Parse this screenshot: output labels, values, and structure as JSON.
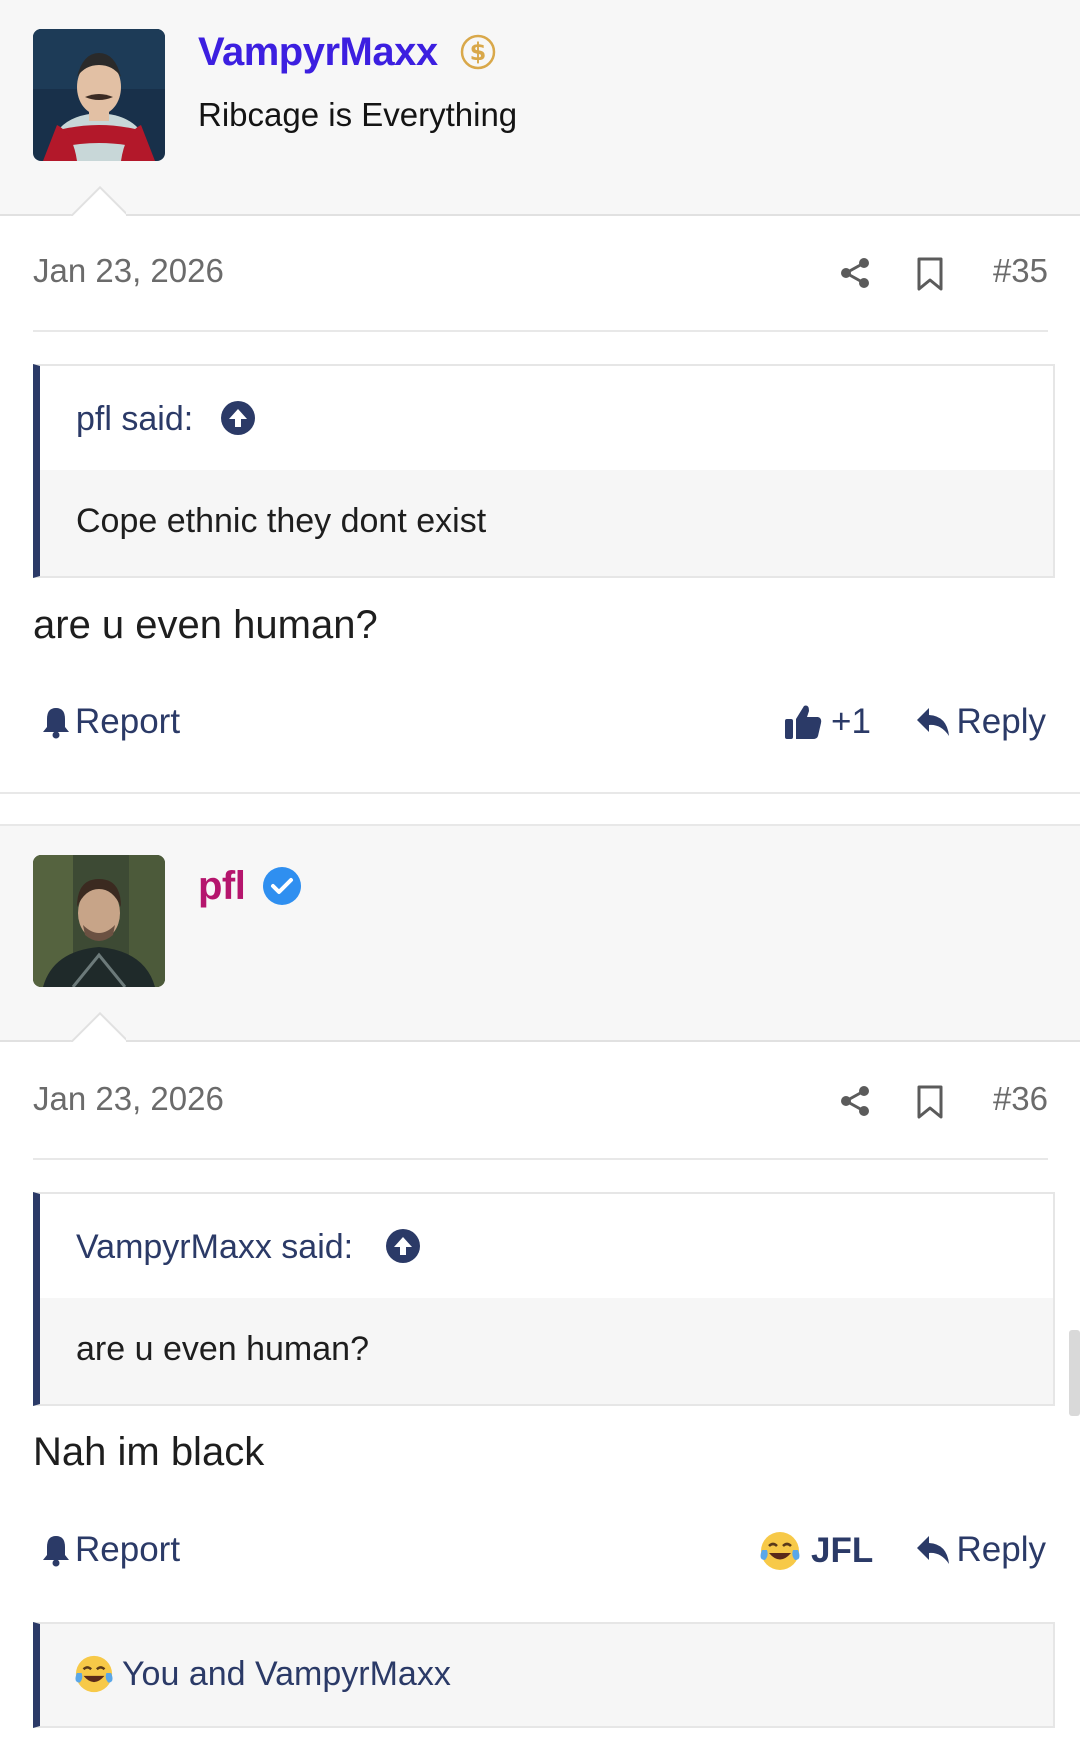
{
  "posts": [
    {
      "author": {
        "name": "VampyrMaxx",
        "title": "Ribcage is Everything",
        "name_color": "#3c1fe0",
        "badge_icon": "dollar-badge-icon"
      },
      "date": "Jan 23, 2026",
      "number": "#35",
      "quote": {
        "attribution": "pfl said:",
        "text": "Cope ethnic they dont exist"
      },
      "message": "are u even human?",
      "actions": {
        "report": "Report",
        "reaction_count": "+1",
        "reaction_icon": "thumbs-up-icon",
        "reply": "Reply"
      }
    },
    {
      "author": {
        "name": "pfl",
        "title": "",
        "name_color": "#b5156d",
        "badge_icon": "verified-badge-icon"
      },
      "date": "Jan 23, 2026",
      "number": "#36",
      "quote": {
        "attribution": "VampyrMaxx said:",
        "text": "are u even human?"
      },
      "message": "Nah im black",
      "actions": {
        "report": "Report",
        "reaction_label": "JFL",
        "reaction_icon": "laughing-crying-emoji-icon",
        "reply": "Reply"
      },
      "reactions_summary": "You and VampyrMaxx"
    }
  ],
  "colors": {
    "accent": "#2b3a67",
    "verified": "#2f8ff0"
  }
}
